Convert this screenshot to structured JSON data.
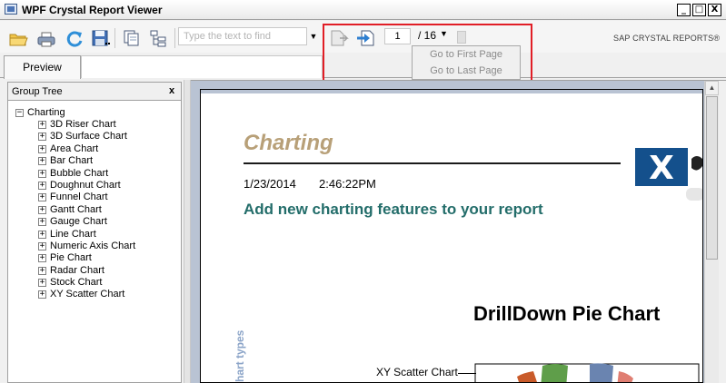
{
  "window": {
    "title": "WPF Crystal Report Viewer",
    "minimize_glyph": "_",
    "maximize_glyph": "□",
    "close_glyph": "X"
  },
  "toolbar": {
    "icons": [
      "open-folder-icon",
      "print-icon",
      "refresh-icon",
      "save-icon",
      "copy-icon",
      "group-tree-toggle-icon",
      "previous-page-icon",
      "next-page-icon"
    ],
    "search_placeholder": "Type the text to find",
    "search_dropdown_glyph": "▼",
    "current_page": "1",
    "total_pages": "/ 16",
    "page_dropdown_glyph": "▼",
    "brand": "SAP CRYSTAL REPORTS®"
  },
  "page_menu": {
    "first": "Go to First Page",
    "last": "Go to Last Page"
  },
  "tabs": {
    "preview": "Preview"
  },
  "group_tree": {
    "title": "Group Tree",
    "close": "x",
    "root": "Charting",
    "root_toggle": "−",
    "item_toggle": "+",
    "items": [
      "3D Riser Chart",
      "3D Surface Chart",
      "Area Chart",
      "Bar Chart",
      "Bubble Chart",
      "Doughnut Chart",
      "Funnel Chart",
      "Gantt Chart",
      "Gauge Chart",
      "Line Chart",
      "Numeric Axis Chart",
      "Pie Chart",
      "Radar Chart",
      "Stock Chart",
      "XY Scatter Chart"
    ]
  },
  "report": {
    "title": "Charting",
    "date": "1/23/2014",
    "time": "2:46:22PM",
    "subtitle": "Add new charting features to your report",
    "pie_title": "DrillDown Pie Chart",
    "vertical_label": "hart types",
    "pie_label": "XY Scatter Chart",
    "logo_glyph": "X"
  },
  "colors": {
    "report_title": "#b8a078",
    "report_subtitle": "#236d6a",
    "logo_blue": "#14508c",
    "highlight": "#e11e26",
    "pie_slices": [
      "#c95b2a",
      "#5f9e4a",
      "#6a84b0",
      "#e07e72"
    ]
  }
}
